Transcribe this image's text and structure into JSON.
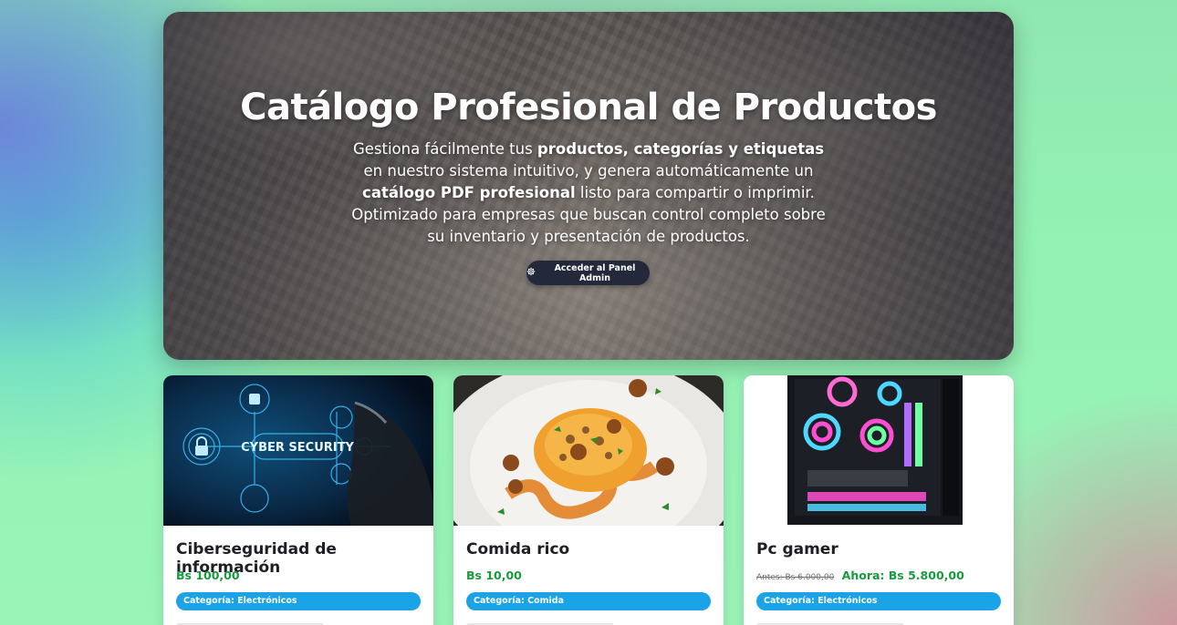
{
  "hero": {
    "title": "Catálogo Profesional de Productos",
    "desc_1": "Gestiona fácilmente tus ",
    "desc_bold_1": "productos, categorías y etiquetas",
    "desc_2": " en nuestro sistema intuitivo, y genera automáticamente un ",
    "desc_bold_2": "catálogo PDF profesional",
    "desc_3": " listo para compartir o imprimir. Optimizado para empresas que buscan control completo sobre su inventario y presentación de productos.",
    "admin_button": "Acceder al Panel Admin",
    "admin_icon": "gear-icon"
  },
  "products": [
    {
      "title": "Ciberseguridad de información",
      "price": "Bs 100,00",
      "category": "Categoría: Electrónicos",
      "image_text": "CYBER SECURITY"
    },
    {
      "title": "Comida rico",
      "price": "Bs 10,00",
      "category": "Categoría: Comida"
    },
    {
      "title": "Pc gamer",
      "price_old": "Antes: Bs 6.000,00",
      "price": "Ahora: Bs 5.800,00",
      "category": "Categoría: Electrónicos"
    }
  ],
  "colors": {
    "price_green": "#1a9a3f",
    "badge_blue": "#1aa3e6",
    "button_dark": "#23283a"
  }
}
